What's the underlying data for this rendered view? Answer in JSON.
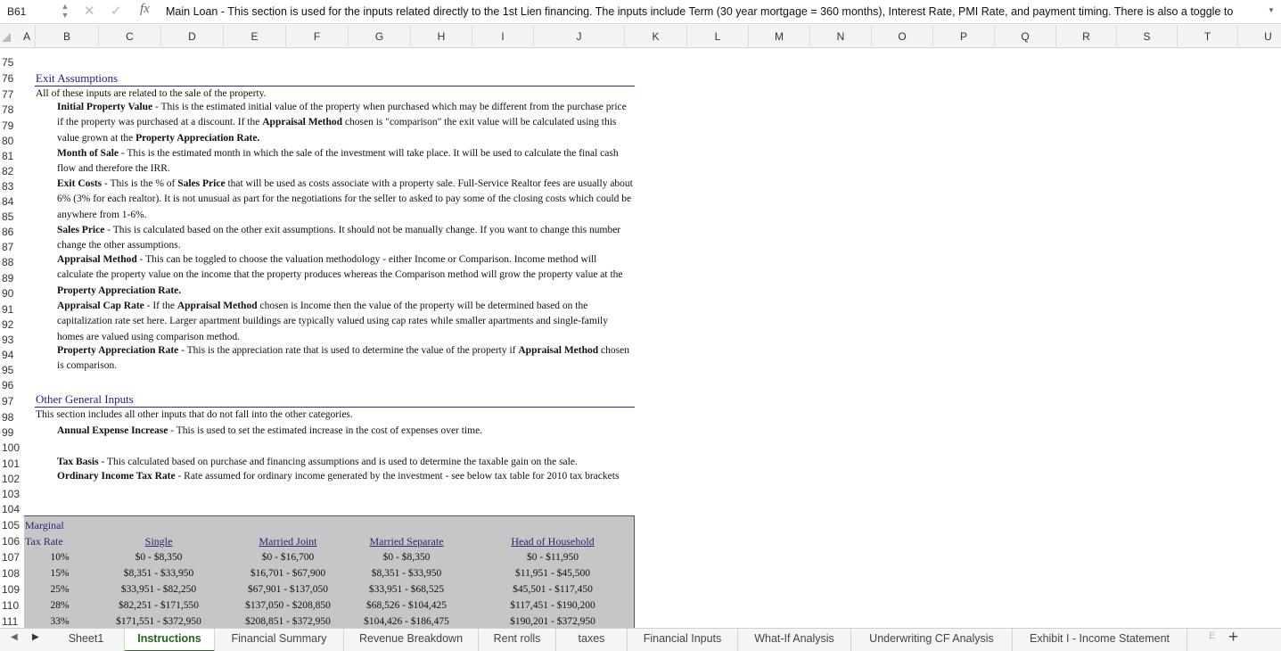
{
  "formula_bar": {
    "cell_ref": "B61",
    "fx": "fx",
    "content": "Main Loan - This section is used for the inputs related directly to the 1st Lien financing.  The inputs include Term (30 year mortgage = 360 months), Interest Rate, PMI Rate, and payment timing.  There is also a toggle to"
  },
  "columns": [
    "A",
    "B",
    "C",
    "D",
    "E",
    "F",
    "G",
    "H",
    "I",
    "J",
    "K",
    "L",
    "M",
    "N",
    "O",
    "P",
    "Q",
    "R",
    "S",
    "T",
    "U"
  ],
  "rows": [
    "75",
    "76",
    "77",
    "78",
    "79",
    "80",
    "81",
    "82",
    "83",
    "84",
    "85",
    "86",
    "87",
    "88",
    "89",
    "90",
    "91",
    "92",
    "93",
    "94",
    "95",
    "96",
    "97",
    "98",
    "99",
    "100",
    "101",
    "102",
    "103",
    "104",
    "105",
    "106",
    "107",
    "108",
    "109",
    "110",
    "111"
  ],
  "exit": {
    "title": "Exit Assumptions",
    "intro": "All of these inputs are related to the sale of the property.",
    "items": [
      {
        "term": "Initial Property Value",
        "pre": " - This is the estimated initial value of the property when purchased which may be different from the purchase price if the property was purchased at a discount.  If the ",
        "t2": "Appraisal Method",
        "mid": " chosen is \"comparison\" the exit value will be calculated using this value grown at the ",
        "t3": "Property Appreciation Rate.",
        "post": ""
      },
      {
        "term": "Month of Sale",
        "pre": " - This is the estimated month in which the sale of the investment will take place.  It will be used to calculate the final cash flow and therefore the IRR.",
        "t2": "",
        "mid": "",
        "t3": "",
        "post": ""
      },
      {
        "term": "Exit Costs",
        "pre": " - This is the % of ",
        "t2": "Sales Price",
        "mid": " that will be used as costs associate with a property sale.  Full-Service Realtor fees are usually about 6% (3% for each realtor).  It is not unusual as part for the negotiations for the seller to asked to pay some of the closing costs which could be anywhere from 1-6%.",
        "t3": "",
        "post": ""
      },
      {
        "term": "Sales Price",
        "pre": " - This is calculated based on the  other  exit assumptions. It should not be manually change. If you want to change this number change the other assumptions.",
        "t2": "",
        "mid": "",
        "t3": "",
        "post": ""
      },
      {
        "term": "Appraisal Method",
        "pre": " - This can be toggled to choose the valuation methodology - either Income or Comparison.  Income method will calculate the property value on the income that the property produces whereas the Comparison method will grow the property value at the ",
        "t2": "Property Appreciation Rate.",
        "mid": "",
        "t3": "",
        "post": ""
      },
      {
        "term": "Appraisal Cap Rate",
        "pre": " - If the ",
        "t2": "Appraisal Method",
        "mid": " chosen is Income then the value of the property will be determined based on the capitalization rate set here.  Larger apartment buildings are typically valued using cap rates while smaller apartments and single-family homes are valued using comparison method.",
        "t3": "",
        "post": ""
      },
      {
        "term": "Property Appreciation Rate",
        "pre": " - This is the appreciation rate that is used to determine the value of the property if ",
        "t2": "Appraisal Method",
        "mid": " chosen is comparison.",
        "t3": "",
        "post": ""
      }
    ]
  },
  "other": {
    "title": "Other General Inputs",
    "intro": "This section includes all other inputs that do not fall into the other categories.",
    "items": [
      {
        "term": "Annual Expense Increase",
        "pre": " - This is used to set the estimated increase in the cost of expenses over time."
      },
      {
        "term": "Tax Basis",
        "pre": " - This calculated based on purchase and financing assumptions and is used to determine the taxable gain on the sale."
      },
      {
        "term": "Ordinary Income Tax Rate",
        "pre": "  - Rate assumed for ordinary income generated by the investment - see below tax table for 2010 tax brackets"
      }
    ]
  },
  "tax_table": {
    "header_line1": "Marginal",
    "headers": [
      "Tax Rate",
      "Single",
      "Married Joint",
      "Married Separate",
      "Head of Household"
    ],
    "rows": [
      [
        "10%",
        "$0 - $8,350",
        "$0 - $16,700",
        "$0 - $8,350",
        "$0 - $11,950"
      ],
      [
        "15%",
        "$8,351 - $33,950",
        "$16,701 - $67,900",
        "$8,351 - $33,950",
        "$11,951 - $45,500"
      ],
      [
        "25%",
        "$33,951 - $82,250",
        "$67,901 - $137,050",
        "$33,951 - $68,525",
        "$45,501 - $117,450"
      ],
      [
        "28%",
        "$82,251 - $171,550",
        "$137,050 - $208,850",
        "$68,526 - $104,425",
        "$117,451 - $190,200"
      ],
      [
        "33%",
        "$171,551 - $372,950",
        "$208,851 - $372,950",
        "$104,426 - $186,475",
        "$190,201 - $372,950"
      ]
    ]
  },
  "tabs": [
    "Sheet1",
    "Instructions",
    "Financial Summary",
    "Revenue Breakdown",
    "Rent rolls",
    "taxes",
    "Financial Inputs",
    "What-If Analysis",
    "Underwriting CF Analysis",
    "Exhibit I - Income Statement"
  ],
  "active_tab": "Instructions",
  "tab_more": "E",
  "tab_add": "+"
}
